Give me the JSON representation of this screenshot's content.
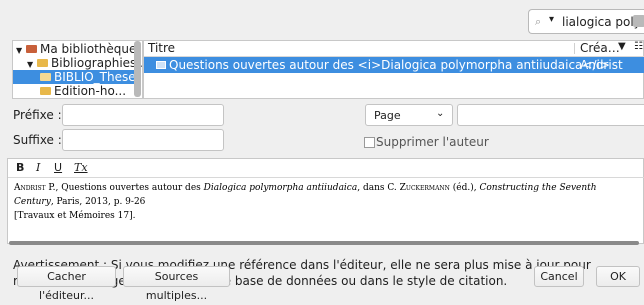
{
  "search": {
    "value": "lialogica poly"
  },
  "library_tree": {
    "items": [
      {
        "label": "Ma bibliothèque",
        "selected": false
      },
      {
        "label": "Bibliographies...",
        "selected": false
      },
      {
        "label": "BIBLIO_These",
        "selected": true
      },
      {
        "label": "Edition-ho...",
        "selected": false
      }
    ]
  },
  "items_table": {
    "columns": [
      "Titre",
      "Créa…"
    ],
    "rows": [
      {
        "title": "Questions ouvertes autour des <i>Dialogica polymorpha antiiudaica</i>",
        "creator": "Andrist"
      }
    ]
  },
  "citation": {
    "prefix_label": "Préfixe :",
    "suffix_label": "Suffixe :",
    "prefix_value": "",
    "suffix_value": "",
    "locator_type": "Page",
    "locator_value": "",
    "suppress_author_label": "Supprimer l'auteur"
  },
  "editor": {
    "toolbar": {
      "bold": "B",
      "italic": "I",
      "underline": "U",
      "clear_format": "Tx"
    },
    "text": {
      "author": "Andrist",
      "p1": " P., Questions ouvertes autour des ",
      "title_italic": "Dialogica polymorpha antiiudaica",
      "p2": ", dans C. ",
      "editor_name": "Zuckermann",
      "p3": " (éd.), ",
      "book_italic": "Constructing the Seventh Century",
      "p4": ", Paris, 2013, p. 9-26",
      "line2": "[Travaux et Mémoires 17]."
    }
  },
  "warning": "Avertissement : Si vous modifiez une référence dans l'éditeur, elle ne sera plus mise à jour pour refléter les changements dans votre base de données ou dans le style de citation.",
  "buttons": {
    "hide_editor": "Cacher l'éditeur...",
    "multiple_sources": "Sources multiples...",
    "cancel": "Cancel",
    "ok": "OK"
  },
  "colors": {
    "selection": "#3d8ee0",
    "folder": "#e8b84a"
  }
}
